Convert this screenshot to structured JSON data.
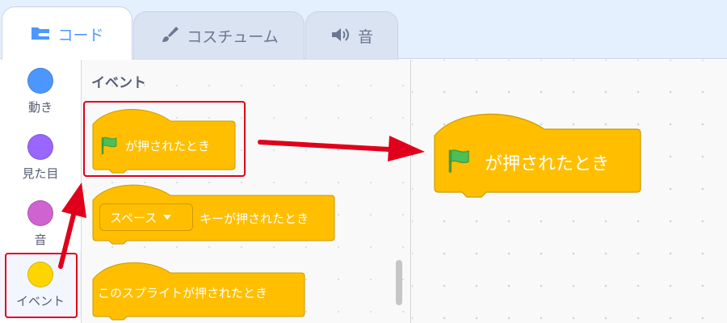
{
  "tabs": [
    {
      "label": "コード",
      "icon": "code-icon",
      "active": true
    },
    {
      "label": "コスチューム",
      "icon": "brush-icon",
      "active": false
    },
    {
      "label": "音",
      "icon": "speaker-icon",
      "active": false
    }
  ],
  "categories": [
    {
      "label": "動き",
      "color": "#4c97ff"
    },
    {
      "label": "見た目",
      "color": "#9966ff"
    },
    {
      "label": "音",
      "color": "#cf63cf"
    },
    {
      "label": "イベント",
      "color": "#ffd500"
    }
  ],
  "palette": {
    "title": "イベント",
    "blocks": {
      "flag_clicked": "が押されたとき",
      "key_pressed_dropdown": "スペース",
      "key_pressed": "キーが押されたとき",
      "sprite_clicked": "このスプライトが押されたとき"
    }
  },
  "workspace": {
    "block_label": "が押されたとき"
  },
  "colors": {
    "event_block": "#ffbf00",
    "event_block_border": "#cc9900",
    "flag": "#4cbf56",
    "annotation": "#e0001b",
    "accent": "#4d97ff"
  }
}
